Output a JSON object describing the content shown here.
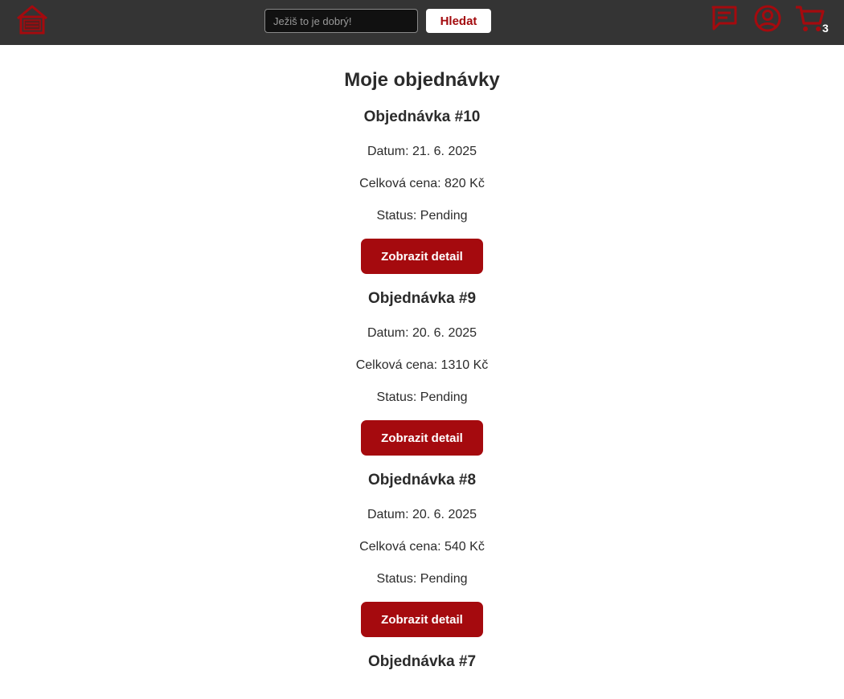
{
  "header": {
    "search": {
      "value": "",
      "placeholder": "Ježiš to je dobrý!"
    },
    "search_button_label": "Hledat",
    "icons": {
      "logo": "home-house-logo",
      "chat": "chat-message-icon",
      "user": "user-account-icon",
      "cart": "shopping-cart-icon"
    },
    "cart_count": "3",
    "accent_color": "#a50a0e",
    "bar_color": "#343434"
  },
  "main": {
    "title": "Moje objednávky",
    "orders": [
      {
        "title": "Objednávka #10",
        "date": "Datum: 21. 6. 2025",
        "total": "Celková cena: 820 Kč",
        "status": "Status: Pending",
        "button": "Zobrazit detail"
      },
      {
        "title": "Objednávka #9",
        "date": "Datum: 20. 6. 2025",
        "total": "Celková cena: 1310 Kč",
        "status": "Status: Pending",
        "button": "Zobrazit detail"
      },
      {
        "title": "Objednávka #8",
        "date": "Datum: 20. 6. 2025",
        "total": "Celková cena: 540 Kč",
        "status": "Status: Pending",
        "button": "Zobrazit detail"
      },
      {
        "title": "Objednávka #7"
      }
    ]
  }
}
